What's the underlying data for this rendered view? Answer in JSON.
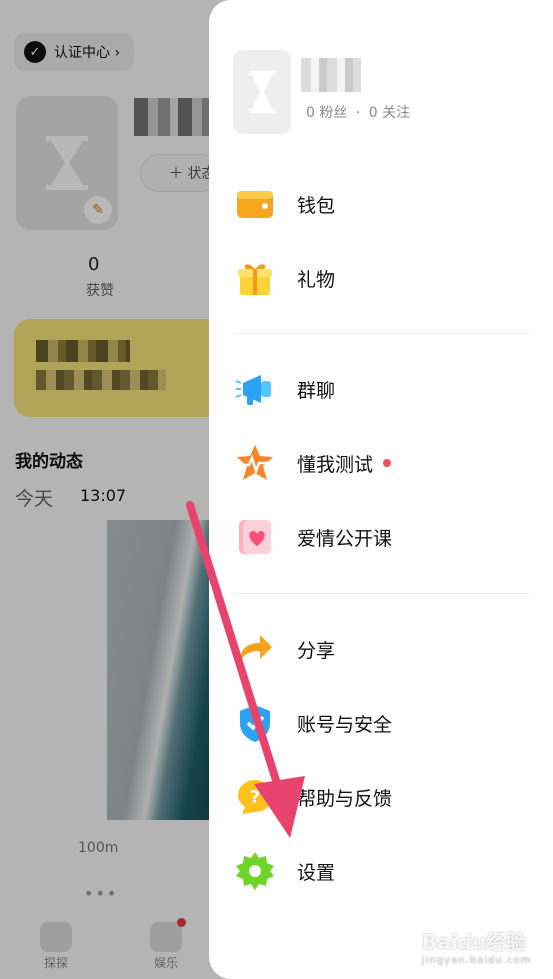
{
  "background": {
    "certification_label": "认证中心 ›",
    "status_button_label": "＋ 状态",
    "likes_count": "0",
    "likes_label": "获赞",
    "my_posts_title": "我的动态",
    "post_day": "今天",
    "post_time": "13:07",
    "post_distance": "100m",
    "more_dots": "•••",
    "tabs": [
      {
        "label": "探探",
        "icon": "chat-bubble-icon"
      },
      {
        "label": "娱乐",
        "icon": "video-play-icon",
        "has_dot": true
      }
    ]
  },
  "drawer": {
    "followers_text": "0 粉丝",
    "separator": "·",
    "following_text": "0 关注",
    "groups": [
      [
        {
          "label": "钱包",
          "icon": "wallet-icon"
        },
        {
          "label": "礼物",
          "icon": "gift-icon"
        }
      ],
      [
        {
          "label": "群聊",
          "icon": "megaphone-icon"
        },
        {
          "label": "懂我测试",
          "icon": "heartbeat-star-icon",
          "has_dot": true
        },
        {
          "label": "爱情公开课",
          "icon": "heart-book-icon"
        }
      ],
      [
        {
          "label": "分享",
          "icon": "share-arrow-icon"
        },
        {
          "label": "账号与安全",
          "icon": "shield-icon"
        },
        {
          "label": "帮助与反馈",
          "icon": "help-bubble-icon"
        },
        {
          "label": "设置",
          "icon": "gear-icon"
        }
      ]
    ]
  },
  "watermark": {
    "text": "Baidu经验",
    "sub": "jingyan.baidu.com"
  },
  "colors": {
    "drawer_bg": "#ffffff",
    "overlay": "rgba(0,0,0,0.28)",
    "annotation_arrow": "#e8436c",
    "notification_dot": "#f0525c"
  }
}
